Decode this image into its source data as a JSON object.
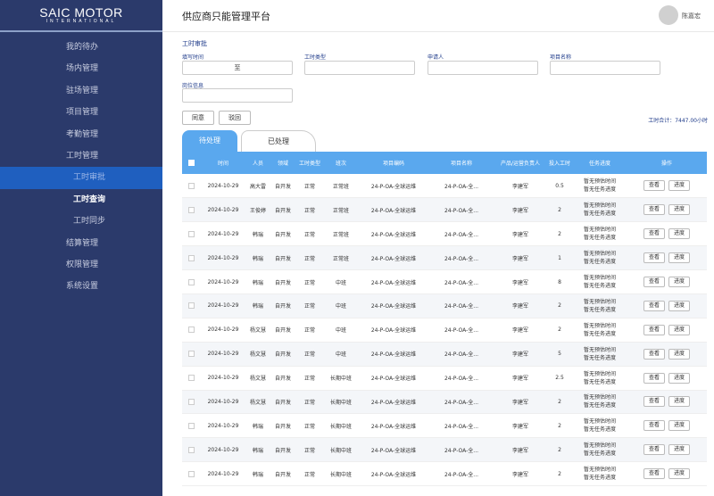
{
  "brand": {
    "main": "SAIC MOTOR",
    "sub": "INTERNATIONAL"
  },
  "sidebar": {
    "items": [
      {
        "label": "我的待办",
        "type": "normal"
      },
      {
        "label": "场内管理",
        "type": "normal"
      },
      {
        "label": "驻场管理",
        "type": "normal"
      },
      {
        "label": "项目管理",
        "type": "normal"
      },
      {
        "label": "考勤管理",
        "type": "normal"
      },
      {
        "label": "工时管理",
        "type": "normal"
      },
      {
        "label": "工时审批",
        "type": "sub-active"
      },
      {
        "label": "工时查询",
        "type": "sub-highlight"
      },
      {
        "label": "工时同步",
        "type": "sub"
      },
      {
        "label": "结算管理",
        "type": "normal"
      },
      {
        "label": "权限管理",
        "type": "normal"
      },
      {
        "label": "系统设置",
        "type": "normal"
      }
    ]
  },
  "header": {
    "title": "供应商只能管理平台",
    "user_name": "陈嘉宏"
  },
  "form": {
    "section_title": "工时审批",
    "fill_time_label": "填写时间",
    "fill_time_value": "至",
    "hours_type_label": "工时类型",
    "applicant_label": "申请人",
    "project_name_label": "项目名称",
    "position_label": "岗位信息"
  },
  "actions": {
    "approve": "同意",
    "reject": "驳回"
  },
  "total_hours": "工时合计：7447.00小时",
  "tabs": {
    "pending": "待处理",
    "processed": "已处理"
  },
  "table": {
    "headers": [
      "",
      "时间",
      "人员",
      "领域",
      "工时类型",
      "班次",
      "项目编码",
      "项目名称",
      "产品/运营负责人",
      "投入工时",
      "任务进度",
      "操作"
    ],
    "progress_line1": "暂无预估时间",
    "progress_line2": "暂无任务进度",
    "view_label": "查看",
    "progress_btn_label": "进度",
    "rows": [
      {
        "date": "2024-10-29",
        "person": "高大雷",
        "domain": "自开发",
        "type": "正常",
        "shift": "正常班",
        "code": "24-P-OA-全球运维",
        "name": "24-P-OA-全...",
        "owner": "李建军",
        "hours": "0.5"
      },
      {
        "date": "2024-10-29",
        "person": "王俊婷",
        "domain": "自开发",
        "type": "正常",
        "shift": "正常班",
        "code": "24-P-OA-全球运维",
        "name": "24-P-OA-全...",
        "owner": "李建军",
        "hours": "2"
      },
      {
        "date": "2024-10-29",
        "person": "韩瑞",
        "domain": "自开发",
        "type": "正常",
        "shift": "正常班",
        "code": "24-P-OA-全球运维",
        "name": "24-P-OA-全...",
        "owner": "李建军",
        "hours": "2"
      },
      {
        "date": "2024-10-29",
        "person": "韩瑞",
        "domain": "自开发",
        "type": "正常",
        "shift": "正常班",
        "code": "24-P-OA-全球运维",
        "name": "24-P-OA-全...",
        "owner": "李建军",
        "hours": "1"
      },
      {
        "date": "2024-10-29",
        "person": "韩瑞",
        "domain": "自开发",
        "type": "正常",
        "shift": "中班",
        "code": "24-P-OA-全球运维",
        "name": "24-P-OA-全...",
        "owner": "李建军",
        "hours": "8"
      },
      {
        "date": "2024-10-29",
        "person": "韩瑞",
        "domain": "自开发",
        "type": "正常",
        "shift": "中班",
        "code": "24-P-OA-全球运维",
        "name": "24-P-OA-全...",
        "owner": "李建军",
        "hours": "2"
      },
      {
        "date": "2024-10-29",
        "person": "杨文慧",
        "domain": "自开发",
        "type": "正常",
        "shift": "中班",
        "code": "24-P-OA-全球运维",
        "name": "24-P-OA-全...",
        "owner": "李建军",
        "hours": "2"
      },
      {
        "date": "2024-10-29",
        "person": "杨文慧",
        "domain": "自开发",
        "type": "正常",
        "shift": "中班",
        "code": "24-P-OA-全球运维",
        "name": "24-P-OA-全...",
        "owner": "李建军",
        "hours": "5"
      },
      {
        "date": "2024-10-29",
        "person": "杨文慧",
        "domain": "自开发",
        "type": "正常",
        "shift": "长期中班",
        "code": "24-P-OA-全球运维",
        "name": "24-P-OA-全...",
        "owner": "李建军",
        "hours": "2.5"
      },
      {
        "date": "2024-10-29",
        "person": "杨文慧",
        "domain": "自开发",
        "type": "正常",
        "shift": "长期中班",
        "code": "24-P-OA-全球运维",
        "name": "24-P-OA-全...",
        "owner": "李建军",
        "hours": "2"
      },
      {
        "date": "2024-10-29",
        "person": "韩瑞",
        "domain": "自开发",
        "type": "正常",
        "shift": "长期中班",
        "code": "24-P-OA-全球运维",
        "name": "24-P-OA-全...",
        "owner": "李建军",
        "hours": "2"
      },
      {
        "date": "2024-10-29",
        "person": "韩瑞",
        "domain": "自开发",
        "type": "正常",
        "shift": "长期中班",
        "code": "24-P-OA-全球运维",
        "name": "24-P-OA-全...",
        "owner": "李建军",
        "hours": "2"
      },
      {
        "date": "2024-10-29",
        "person": "韩瑞",
        "domain": "自开发",
        "type": "正常",
        "shift": "长期中班",
        "code": "24-P-OA-全球运维",
        "name": "24-P-OA-全...",
        "owner": "李建军",
        "hours": "2"
      }
    ]
  },
  "colors": {
    "sidebar_bg": "#2b3a6b",
    "active_nav": "#1f5fbf",
    "table_header": "#5aa8ee",
    "label_blue": "#1f3b8a"
  }
}
